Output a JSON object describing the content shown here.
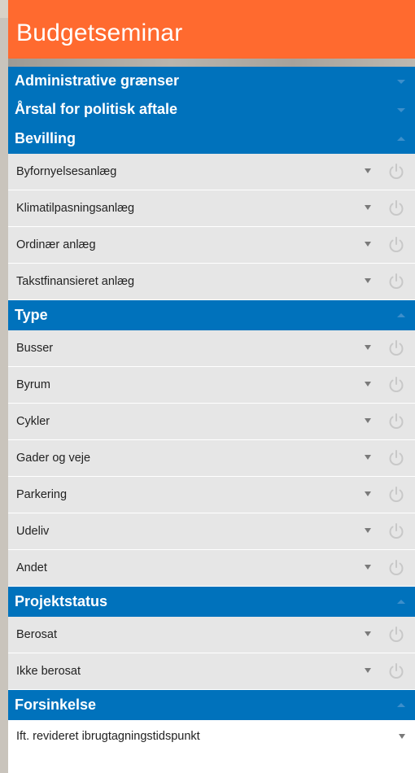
{
  "app": {
    "title": "Budgetseminar"
  },
  "colors": {
    "title_bar": "#ff6a2f",
    "section_header": "#0072bc",
    "item_bg": "#e6e6e6"
  },
  "sections": [
    {
      "label": "Administrative grænser",
      "state": "collapsed",
      "items": []
    },
    {
      "label": "Årstal for politisk aftale",
      "state": "collapsed",
      "items": []
    },
    {
      "label": "Bevilling",
      "state": "expanded",
      "items": [
        "Byfornyelsesanlæg",
        "Klimatilpasningsanlæg",
        "Ordinær anlæg",
        "Takstfinansieret anlæg"
      ]
    },
    {
      "label": "Type",
      "state": "expanded",
      "items": [
        "Busser",
        "Byrum",
        "Cykler",
        "Gader og veje",
        "Parkering",
        "Udeliv",
        "Andet"
      ]
    },
    {
      "label": "Projektstatus",
      "state": "expanded",
      "items": [
        "Berosat",
        "Ikke berosat"
      ]
    },
    {
      "label": "Forsinkelse",
      "state": "expanded",
      "select": {
        "value": "Ift. revideret ibrugtagningstidspunkt"
      }
    }
  ],
  "icons": {
    "item_dropdown": "caret-down-icon",
    "item_toggle": "power-icon",
    "section_toggle": "chevron-icon"
  }
}
